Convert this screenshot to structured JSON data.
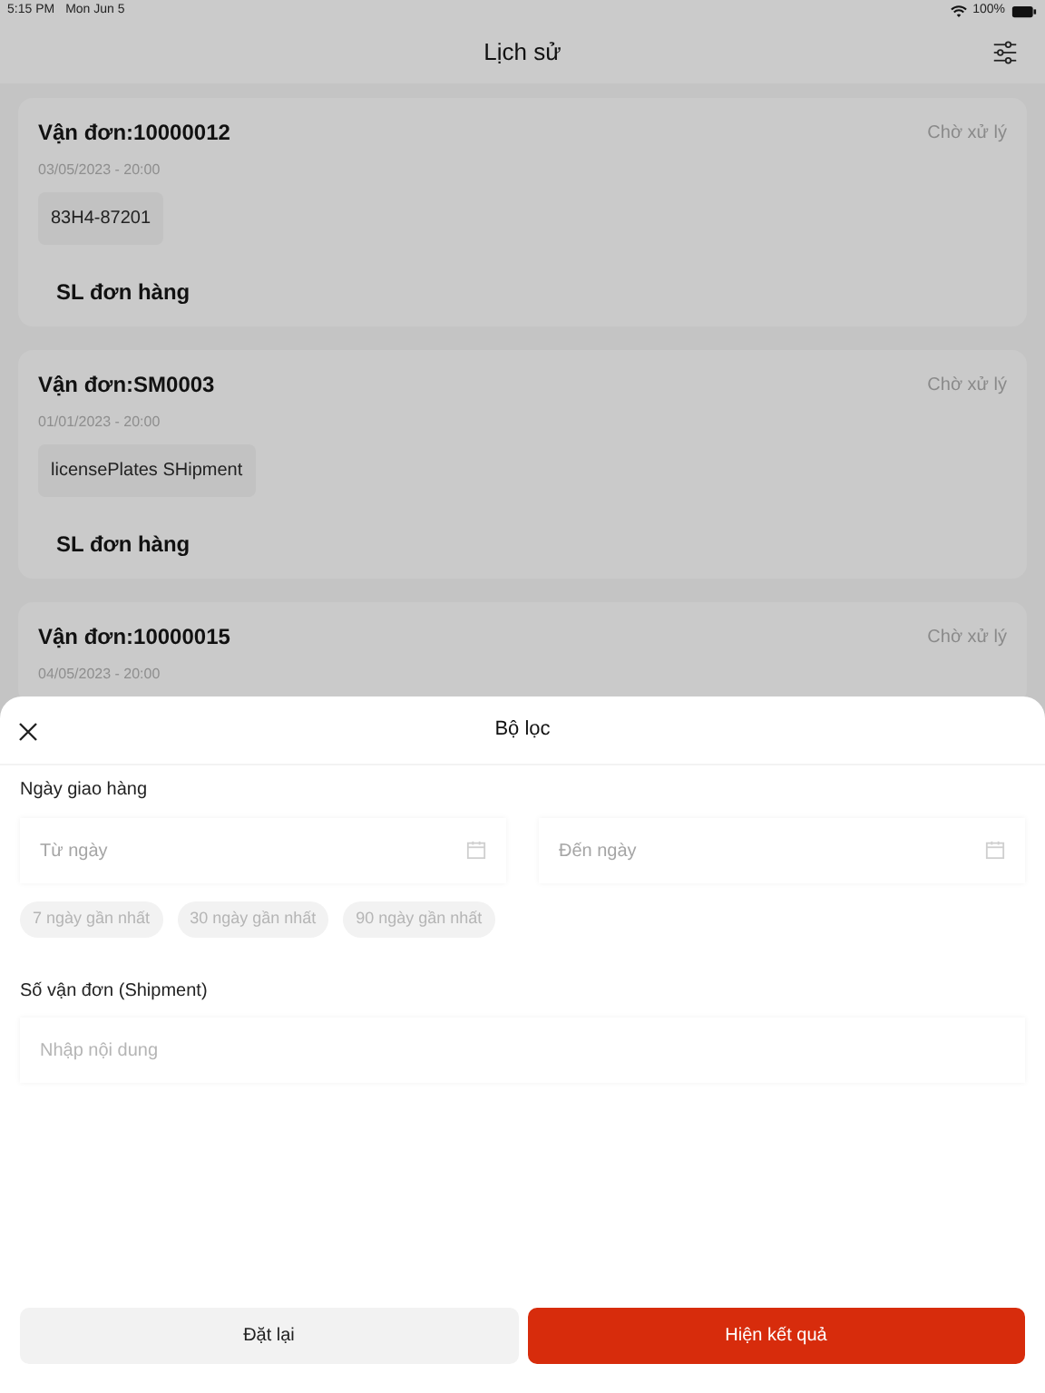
{
  "status_bar": {
    "time": "5:15 PM",
    "date": "Mon Jun 5",
    "battery": "100%"
  },
  "header": {
    "title": "Lịch sử"
  },
  "orders": [
    {
      "title": "Vận đơn:10000012",
      "status": "Chờ xử lý",
      "datetime": "03/05/2023 - 20:00",
      "plate": "83H4-87201",
      "count_label": "SL đơn hàng"
    },
    {
      "title": "Vận đơn:SM0003",
      "status": "Chờ xử lý",
      "datetime": "01/01/2023 - 20:00",
      "plate": "licensePlates SHipment",
      "count_label": "SL đơn hàng"
    },
    {
      "title": "Vận đơn:10000015",
      "status": "Chờ xử lý",
      "datetime": "04/05/2023 - 20:00"
    }
  ],
  "filter_sheet": {
    "title": "Bộ lọc",
    "date_section": {
      "label": "Ngày giao hàng",
      "from_placeholder": "Từ ngày",
      "to_placeholder": "Đến ngày"
    },
    "quick_ranges": [
      {
        "label": "7 ngày gần nhất",
        "selected": false
      },
      {
        "label": "30 ngày gần nhất",
        "selected": false
      },
      {
        "label": "90 ngày gần nhất",
        "selected": false
      }
    ],
    "shipment_section": {
      "label": "Số vận đơn (Shipment)",
      "placeholder": "Nhập nội dung"
    },
    "buttons": [
      {
        "label": "Đặt lại",
        "kind": "secondary"
      },
      {
        "label": "Hiện kết quả",
        "kind": "primary"
      }
    ]
  }
}
